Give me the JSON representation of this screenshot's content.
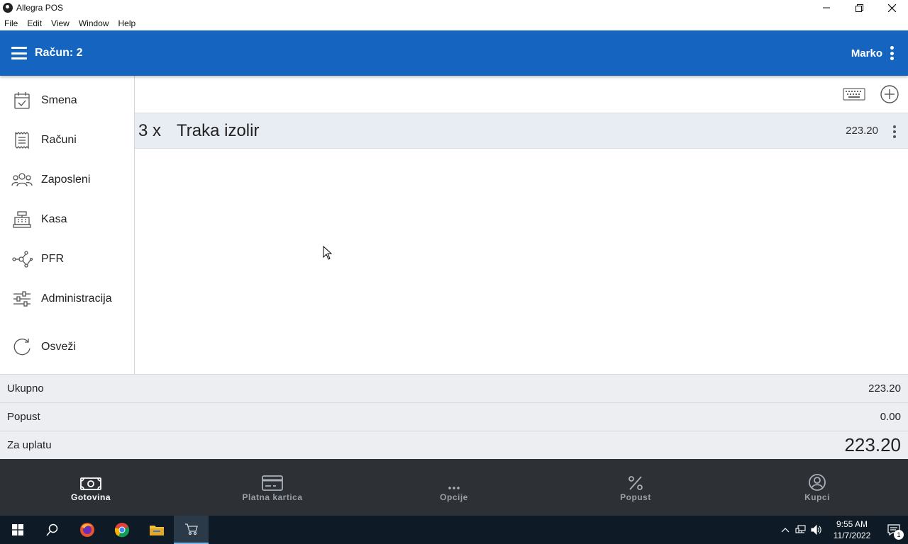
{
  "window": {
    "title": "Allegra POS",
    "controls": [
      "minimize-icon",
      "restore-icon",
      "close-icon"
    ]
  },
  "menu": [
    "File",
    "Edit",
    "View",
    "Window",
    "Help"
  ],
  "header": {
    "title": "Račun: 2",
    "user": "Marko",
    "color": "#1565c0"
  },
  "sidebar": {
    "items": [
      {
        "label": "Smena",
        "icon": "calendar-check-icon"
      },
      {
        "label": "Računi",
        "icon": "receipt-icon"
      },
      {
        "label": "Zaposleni",
        "icon": "people-icon"
      },
      {
        "label": "Kasa",
        "icon": "cash-register-icon"
      },
      {
        "label": "PFR",
        "icon": "network-icon"
      },
      {
        "label": "Administracija",
        "icon": "sliders-icon"
      },
      {
        "label": "Osveži",
        "icon": "refresh-icon"
      }
    ]
  },
  "bill": {
    "items": [
      {
        "qty": "3 x",
        "name": "Traka izolir",
        "price": "223.20"
      }
    ]
  },
  "totals": {
    "ukupno_label": "Ukupno",
    "ukupno_value": "223.20",
    "popust_label": "Popust",
    "popust_value": "0.00",
    "za_uplatu_label": "Za uplatu",
    "za_uplatu_value": "223.20"
  },
  "actions": [
    {
      "label": "Gotovina",
      "icon": "cash-icon",
      "active": true
    },
    {
      "label": "Platna kartica",
      "icon": "credit-card-icon",
      "active": false
    },
    {
      "label": "Opcije",
      "icon": "more-horizontal-icon",
      "active": false
    },
    {
      "label": "Popust",
      "icon": "percent-icon",
      "active": false
    },
    {
      "label": "Kupci",
      "icon": "account-circle-icon",
      "active": false
    }
  ],
  "taskbar": {
    "time": "9:55 AM",
    "date": "11/7/2022",
    "notification_count": "1"
  }
}
